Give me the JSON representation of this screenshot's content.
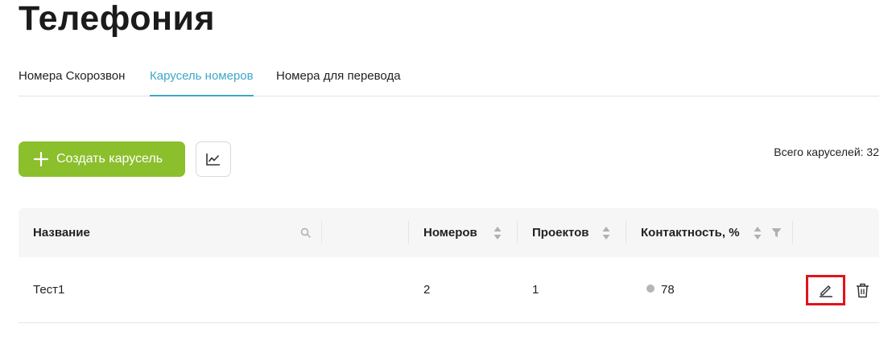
{
  "page": {
    "title": "Телефония"
  },
  "tabs": [
    {
      "label": "Номера Скорозвон",
      "active": false
    },
    {
      "label": "Карусель номеров",
      "active": true
    },
    {
      "label": "Номера для перевода",
      "active": false
    }
  ],
  "toolbar": {
    "create_label": "Создать карусель",
    "total_label": "Всего каруселей: 32"
  },
  "colors": {
    "accent_tab": "#3ea7c9",
    "create_button": "#8bbf2c",
    "highlight_box": "#e0141b"
  },
  "table": {
    "columns": [
      {
        "label": "Название",
        "icon": "search-icon"
      },
      {
        "label": "Номеров",
        "icon": "sort-icon"
      },
      {
        "label": "Проектов",
        "icon": "sort-icon"
      },
      {
        "label": "Контактность, %",
        "icon": "sort-icon",
        "filter": "filter-icon"
      }
    ],
    "rows": [
      {
        "name": "Тест1",
        "numbers": "2",
        "projects": "1",
        "contact": "78"
      }
    ]
  }
}
